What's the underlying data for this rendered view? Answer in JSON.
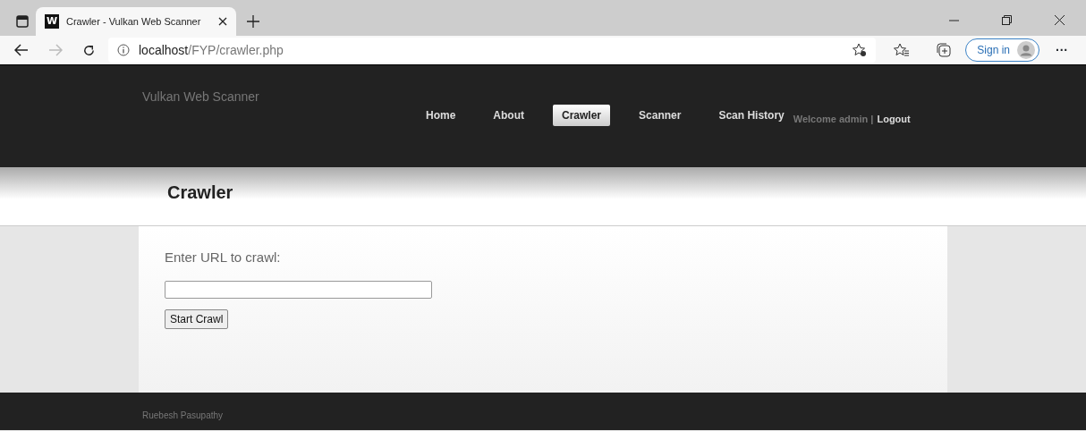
{
  "browser": {
    "tab_title": "Crawler - Vulkan Web Scanner",
    "tab_favicon": "W",
    "url_host": "localhost",
    "url_path": "/FYP/crawler.php",
    "sign_in": "Sign in",
    "more": "···"
  },
  "site": {
    "brand": "Vulkan Web Scanner",
    "nav": [
      {
        "label": "Home",
        "selected": false
      },
      {
        "label": "About",
        "selected": false
      },
      {
        "label": "Crawler",
        "selected": true
      },
      {
        "label": "Scanner",
        "selected": false
      },
      {
        "label": "Scan History",
        "selected": false
      }
    ],
    "welcome": "Welcome admin |",
    "logout": "Logout"
  },
  "page": {
    "heading": "Crawler",
    "form_label": "Enter URL to crawl:",
    "button": "Start Crawl"
  },
  "footer": {
    "text": "Ruebesh Pasupathy"
  }
}
